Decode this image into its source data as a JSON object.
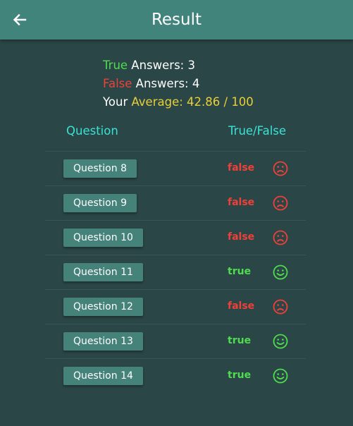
{
  "header": {
    "title": "Result",
    "back_icon": "arrow-left-icon"
  },
  "summary": {
    "true_word": "True",
    "true_rest": " Answers: 3",
    "false_word": "False",
    "false_rest": " Answers: 4",
    "avg_prefix": "Your ",
    "avg_label": "Average: 42.86 / 100"
  },
  "columns": {
    "question": "Question",
    "truefalse": "True/False"
  },
  "colors": {
    "true": "#4fdc4f",
    "false": "#f0403a",
    "average": "#e8cf3a",
    "accent": "#39e3d6",
    "appbar": "#40847c"
  },
  "results": [
    {
      "question": "Question 8",
      "status": "false",
      "icon": "sad-face-icon"
    },
    {
      "question": "Question 9",
      "status": "false",
      "icon": "sad-face-icon"
    },
    {
      "question": "Question 10",
      "status": "false",
      "icon": "sad-face-icon"
    },
    {
      "question": "Question 11",
      "status": "true",
      "icon": "happy-face-icon"
    },
    {
      "question": "Question 12",
      "status": "false",
      "icon": "sad-face-icon"
    },
    {
      "question": "Question 13",
      "status": "true",
      "icon": "happy-face-icon"
    },
    {
      "question": "Question 14",
      "status": "true",
      "icon": "happy-face-icon"
    }
  ]
}
